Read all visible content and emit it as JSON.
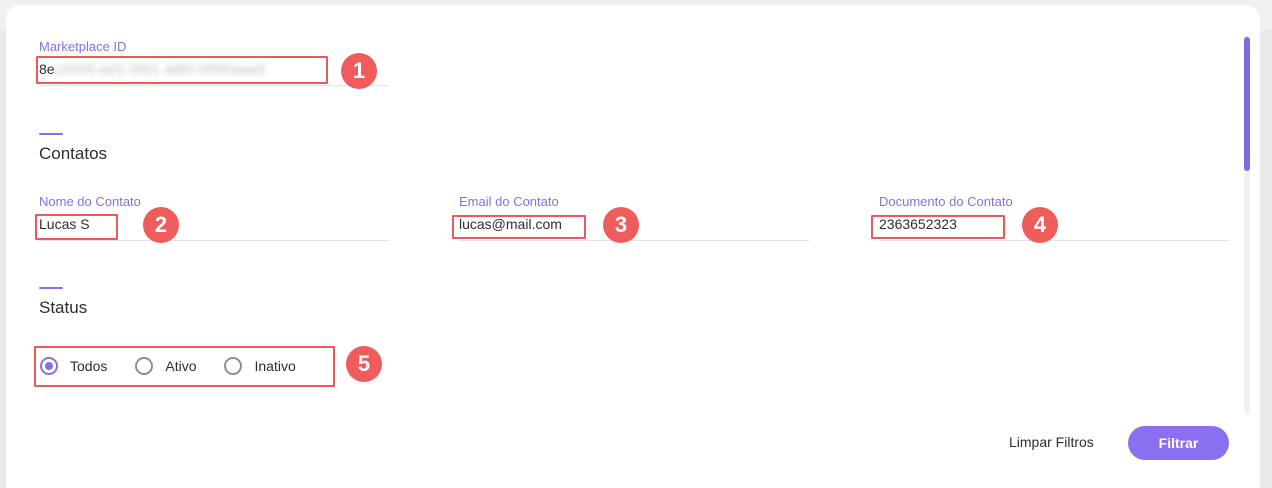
{
  "marketplace": {
    "label": "Marketplace ID",
    "value_visible": "8e",
    "value_redacted": "c0000-a01-0f01-a8f0-0f0f0aaa0"
  },
  "contatos": {
    "title": "Contatos",
    "nome": {
      "label": "Nome do Contato",
      "value": "Lucas S"
    },
    "email": {
      "label": "Email do Contato",
      "value": "lucas@mail.com"
    },
    "documento": {
      "label": "Documento do Contato",
      "value": "2363652323"
    }
  },
  "status": {
    "title": "Status",
    "options": [
      {
        "label": "Todos",
        "selected": true
      },
      {
        "label": "Ativo",
        "selected": false
      },
      {
        "label": "Inativo",
        "selected": false
      }
    ]
  },
  "actions": {
    "clear_label": "Limpar Filtros",
    "filter_label": "Filtrar"
  },
  "annotations": [
    "1",
    "2",
    "3",
    "4",
    "5"
  ],
  "colors": {
    "accent": "#8a6fe0",
    "button": "#8a6ff0",
    "annotation": "#ee5c5c"
  }
}
